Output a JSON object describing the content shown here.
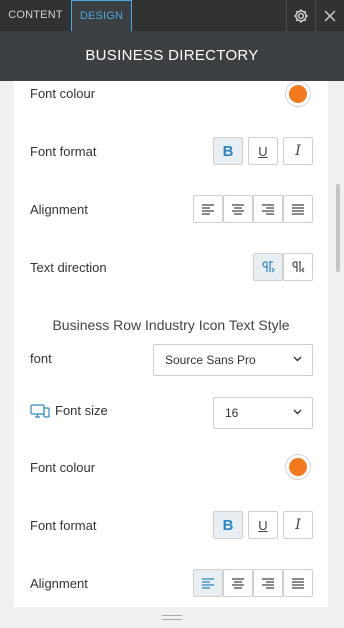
{
  "tabs": {
    "content": "CONTENT",
    "design": "DESIGN"
  },
  "icons": {
    "settings": "gear-icon",
    "close": "close-icon",
    "device": "desktop-tablet-icon",
    "chevron": "chevron-down-icon"
  },
  "colors": {
    "accent": "#2e86c1",
    "header_bg": "#3d4043",
    "tabbar_bg": "#2f3133",
    "font_colour_swatch": "#f47a20"
  },
  "header": {
    "title": "BUSINESS DIRECTORY"
  },
  "section1": {
    "font_colour_label": "Font colour",
    "font_format_label": "Font format",
    "alignment_label": "Alignment",
    "text_direction_label": "Text direction",
    "bold_glyph": "B",
    "underline_glyph": "U",
    "italic_glyph": "I"
  },
  "section2": {
    "title": "Business Row Industry Icon Text Style",
    "font_label": "font",
    "font_value": "Source Sans Pro",
    "font_size_label": "Font size",
    "font_size_value": "16",
    "font_colour_label": "Font colour",
    "font_format_label": "Font format",
    "alignment_label": "Alignment",
    "bold_glyph": "B",
    "underline_glyph": "U",
    "italic_glyph": "I"
  }
}
